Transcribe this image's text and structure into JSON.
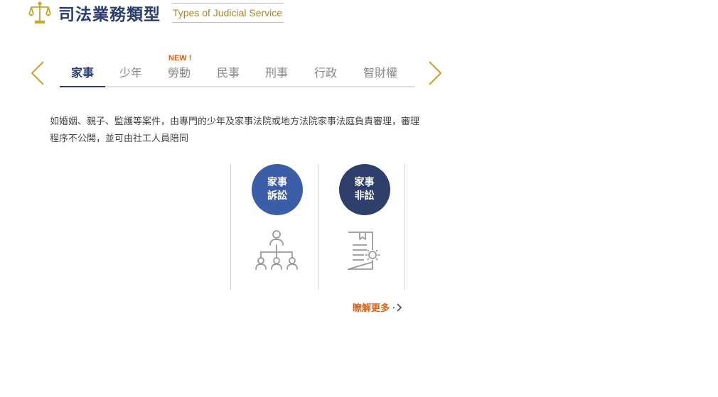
{
  "header": {
    "title": "司法業務類型",
    "subtitle": "Types of Judicial Service"
  },
  "tabs": [
    {
      "label": "家事",
      "active": true
    },
    {
      "label": "少年",
      "active": false
    },
    {
      "label": "勞動",
      "active": false
    },
    {
      "label": "民事",
      "active": false
    },
    {
      "label": "刑事",
      "active": false
    },
    {
      "label": "行政",
      "active": false
    },
    {
      "label": "智財權",
      "active": false
    }
  ],
  "new_badge": "NEW !",
  "description": "如婚姻、親子、監護等案件，由專門的少年及家事法院或地方法院家事法庭負責審理，審理程序不公開，並可由社工人員陪同",
  "cards": [
    {
      "line1": "家事",
      "line2": "訴訟",
      "icon": "organization-chart-icon"
    },
    {
      "line1": "家事",
      "line2": "非訟",
      "icon": "document-settings-icon"
    }
  ],
  "more_link": "瞭解更多",
  "colors": {
    "navy": "#2c3e70",
    "gold": "#a8862a",
    "accent": "#d8601b",
    "card1": "#3c5ea9",
    "card2": "#2e3f6c"
  }
}
